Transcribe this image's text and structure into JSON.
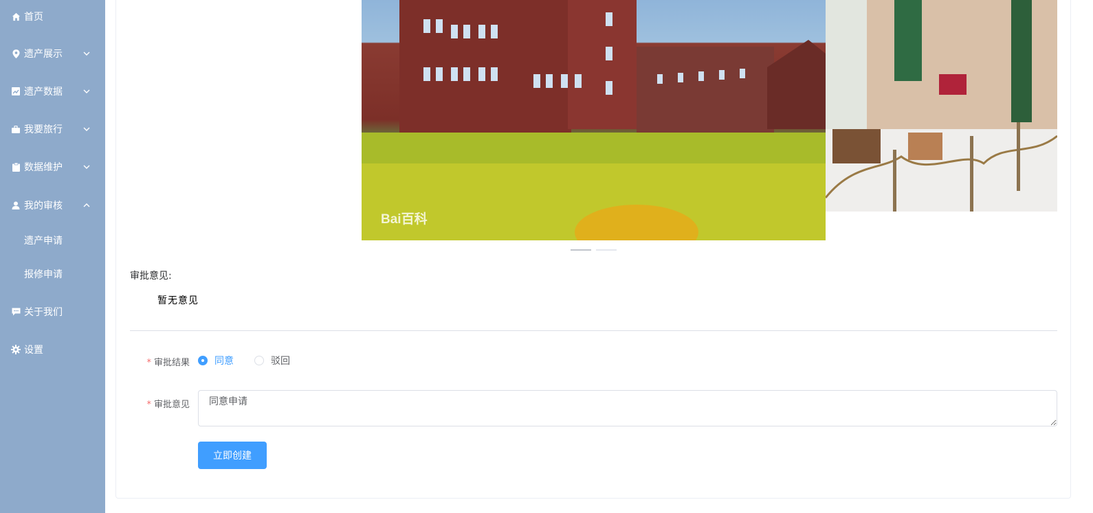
{
  "sidebar": {
    "items": [
      {
        "label": "首页",
        "icon": "home-icon"
      },
      {
        "label": "遗产展示",
        "icon": "location-icon"
      },
      {
        "label": "遗产数据",
        "icon": "chart-icon"
      },
      {
        "label": "我要旅行",
        "icon": "briefcase-icon"
      },
      {
        "label": "数据维护",
        "icon": "clipboard-icon"
      },
      {
        "label": "我的审核",
        "icon": "user-icon"
      },
      {
        "label": "关于我们",
        "icon": "chat-icon"
      },
      {
        "label": "设置",
        "icon": "gear-icon"
      }
    ],
    "subitems": [
      {
        "label": "遗产申请"
      },
      {
        "label": "报修申请"
      }
    ]
  },
  "carousel": {
    "active_index": 0,
    "indicator_count": 2,
    "watermark": "Bai百科"
  },
  "approval": {
    "opinion_label": "审批意见:",
    "opinion_text": "暂无意见"
  },
  "form": {
    "result_label": "审批结果",
    "result_options": [
      "同意",
      "驳回"
    ],
    "result_selected": "同意",
    "comment_label": "审批意见",
    "comment_value": "同意申请",
    "submit_label": "立即创建"
  },
  "colors": {
    "sidebar_bg": "#8eaacb",
    "primary": "#409eff",
    "required": "#f56c6c"
  }
}
